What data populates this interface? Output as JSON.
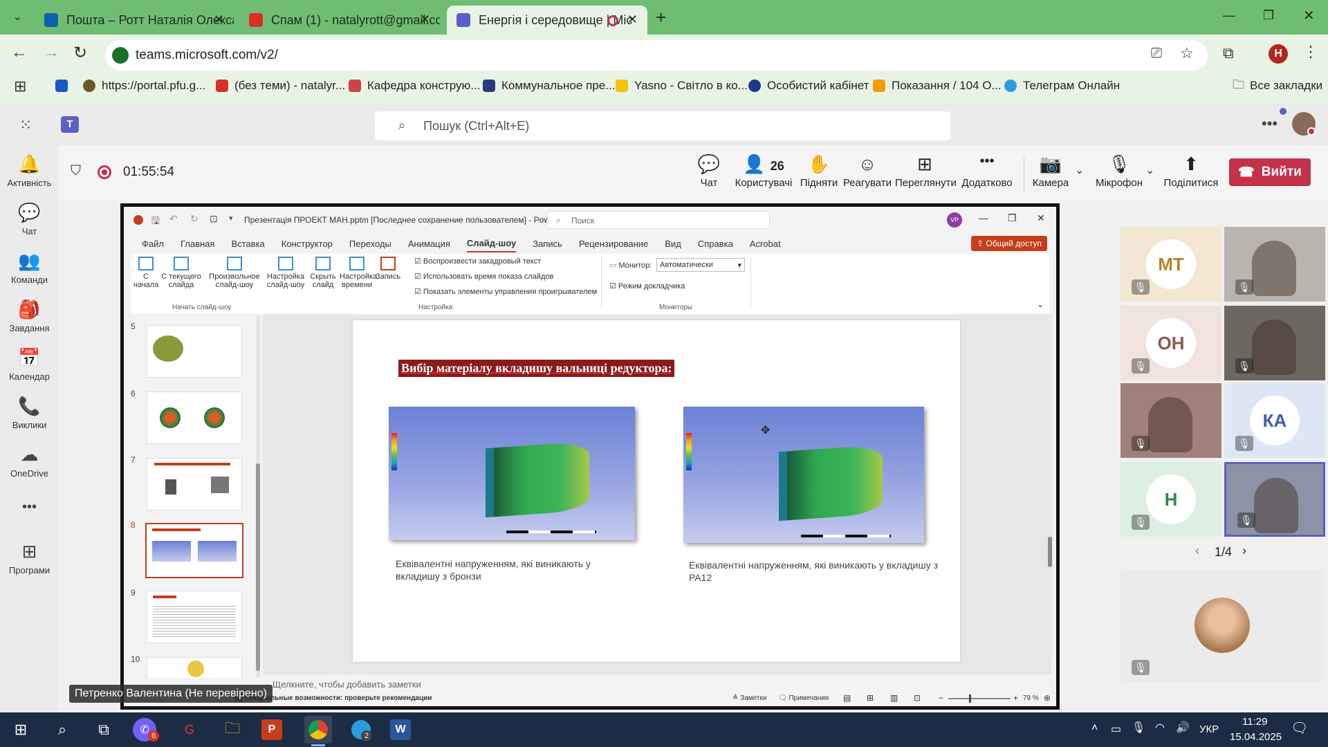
{
  "browser": {
    "tabs": [
      {
        "title": "Пошта – Ротт Наталія Олексан",
        "favicon_color": "#0a64ad"
      },
      {
        "title": "Спам (1) - natalyrott@gmail.co",
        "favicon_color": "#d93025"
      },
      {
        "title": "Енергія і середовище | Mic",
        "favicon_color": "#5b5fc7"
      }
    ],
    "new_tab": "+",
    "url": "teams.microsoft.com/v2/",
    "profile_initial": "H",
    "bookmarks": [
      "https://portal.pfu.g...",
      "(без теми) - natalyr...",
      "Кафедра конструю...",
      "Коммунальное пре...",
      "Yasno - Світло в ко...",
      "Особистий кабінет",
      "Показання / 104 О...",
      "Телеграм Онлайн"
    ],
    "all_bookmarks": "Все закладки"
  },
  "teams": {
    "search_placeholder": "Пошук (Ctrl+Alt+E)",
    "rail": [
      {
        "label": "Активність",
        "icon": "bell-icon",
        "glyph": "🔔"
      },
      {
        "label": "Чат",
        "icon": "chat-icon",
        "glyph": "💬"
      },
      {
        "label": "Команди",
        "icon": "teams-icon",
        "glyph": "👥"
      },
      {
        "label": "Завдання",
        "icon": "tasks-icon",
        "glyph": "🎒"
      },
      {
        "label": "Календар",
        "icon": "calendar-icon",
        "glyph": "📅"
      },
      {
        "label": "Виклики",
        "icon": "phone-icon",
        "glyph": "📞"
      },
      {
        "label": "OneDrive",
        "icon": "cloud-icon",
        "glyph": "☁"
      },
      {
        "label": "",
        "icon": "more-icon",
        "glyph": "•••"
      },
      {
        "label": "Програми",
        "icon": "apps-icon",
        "glyph": "⊞"
      }
    ],
    "meeting": {
      "timer": "01:55:54",
      "participants_count": "26",
      "buttons": [
        {
          "label": "Чат",
          "icon": "chat-icon",
          "glyph": "💬"
        },
        {
          "label": "Користувачі",
          "icon": "people-icon",
          "glyph": "👤"
        },
        {
          "label": "Підняти",
          "icon": "hand-icon",
          "glyph": "✋"
        },
        {
          "label": "Реагувати",
          "icon": "emoji-icon",
          "glyph": "☺"
        },
        {
          "label": "Переглянути",
          "icon": "view-icon",
          "glyph": "⊞"
        },
        {
          "label": "Додатково",
          "icon": "more-icon",
          "glyph": "•••"
        },
        {
          "label": "Камера",
          "icon": "camera-off-icon",
          "glyph": "📷"
        },
        {
          "label": "Мікрофон",
          "icon": "mic-off-icon",
          "glyph": "🎙"
        },
        {
          "label": "Поділитися",
          "icon": "share-icon",
          "glyph": "⬆"
        }
      ],
      "leave": "Вийти",
      "presenter_label": "Петренко Валентина (Не перевірено)"
    },
    "gallery": {
      "tiles": [
        {
          "initials": "МТ",
          "bg": "#f3e6d2",
          "fg": "#b9822c"
        },
        {
          "initials": "",
          "bg": "#b9b4ad",
          "fg": ""
        },
        {
          "initials": "ОН",
          "bg": "#f0e2dc",
          "fg": "#8b5a4a"
        },
        {
          "initials": "",
          "bg": "#6c6760",
          "fg": ""
        },
        {
          "initials": "",
          "bg": "#a08078",
          "fg": ""
        },
        {
          "initials": "КА",
          "bg": "#dde6f4",
          "fg": "#3d5ea8"
        },
        {
          "initials": "Н",
          "bg": "#dcefe2",
          "fg": "#2c8c4c"
        },
        {
          "initials": "",
          "bg": "#8c93a6",
          "fg": ""
        }
      ],
      "page": "1/4"
    }
  },
  "powerpoint": {
    "title": "Презентація ПРОЕКТ МАН.pptm [Последнее сохранение пользователем] - PowerP...",
    "search": "Поиск",
    "user_initials": "VP",
    "menu": [
      "Файл",
      "Главная",
      "Вставка",
      "Конструктор",
      "Переходы",
      "Анимация",
      "Слайд-шоу",
      "Запись",
      "Рецензирование",
      "Вид",
      "Справка",
      "Acrobat"
    ],
    "active_menu": "Слайд-шоу",
    "share_button": "Общий доступ",
    "ribbon": {
      "start_buttons": [
        "С начала",
        "С текущего слайда",
        "Произвольное слайд-шоу"
      ],
      "start_group": "Начать слайд-шоу",
      "setup_buttons": [
        "Настройка слайд-шоу",
        "Скрыть слайд",
        "Настройка времени",
        "Запись"
      ],
      "checks": [
        "Воспроизвести закадровый текст",
        "Использовать время показа слайдов",
        "Показать элементы управления проигрывателем"
      ],
      "setup_group": "Настройка",
      "monitor_label": "Монитор:",
      "monitor_value": "Автоматически",
      "presenter_mode": "Режим докладчика",
      "monitors_group": "Мониторы"
    },
    "thumbs": [
      "5",
      "6",
      "7",
      "8",
      "9",
      "10"
    ],
    "slide": {
      "title": "Вибір матеріалу вкладишу вальниці редуктора:",
      "caption_left": "Еквівалентні напруженням, які виникають у вкладишу з бронзи",
      "caption_right": "Еквівалентні напруженням, які виникають у вкладишу з PA12"
    },
    "notes_placeholder": "Щелкните, чтобы добавить заметки",
    "status": {
      "accessibility": "Специальные возможности: проверьте рекомендации",
      "notes": "Заметки",
      "comments": "Примечания",
      "zoom": "79 %"
    }
  },
  "taskbar": {
    "lang": "УКР",
    "time": "11:29",
    "date": "15.04.2025",
    "viber_badge": "6",
    "telegram_badge": "2"
  }
}
